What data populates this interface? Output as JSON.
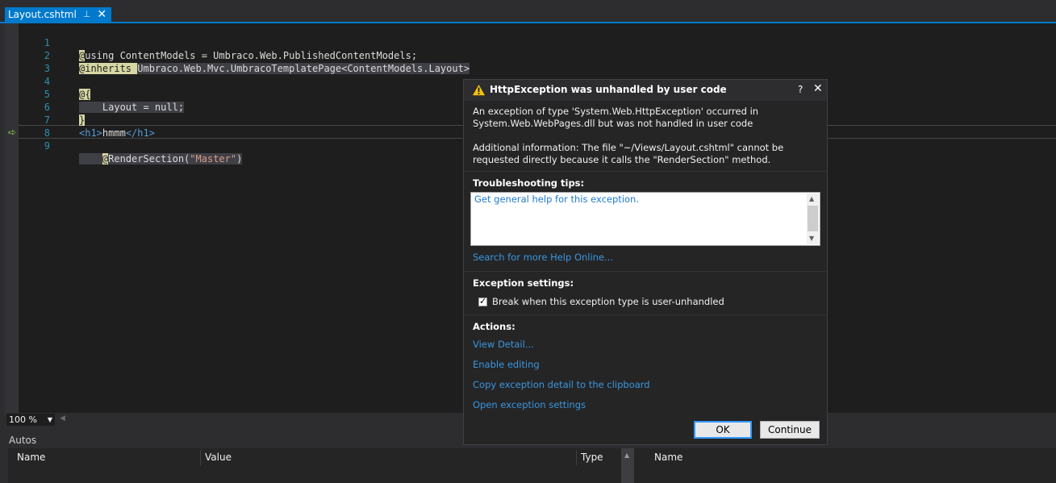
{
  "tab": {
    "title": "Layout.cshtml",
    "pin": "⊥",
    "close": "✕"
  },
  "editor": {
    "lines": [
      {
        "num": "1",
        "a": "@",
        "b": "using ContentModels = Umbraco.Web.PublishedContentModels;"
      },
      {
        "num": "2",
        "a": "@inherits ",
        "b": "Umbraco.Web.Mvc.UmbracoTemplatePage<ContentModels.Layout>"
      },
      {
        "num": "3",
        "a": "",
        "b": ""
      },
      {
        "num": "4",
        "a": "@{",
        "b": ""
      },
      {
        "num": "5",
        "a": "",
        "b": "    Layout = null;"
      },
      {
        "num": "6",
        "a": "}",
        "b": ""
      },
      {
        "num": "7",
        "tag1": "<h1>",
        "text": "hmmm",
        "tag2": "</h1>"
      },
      {
        "num": "8",
        "a": "",
        "b": ""
      },
      {
        "num": "9",
        "a": "@",
        "b": "RenderSection(",
        "str": "\"Master\"",
        "c": ")"
      }
    ]
  },
  "zoom": {
    "value": "100 %"
  },
  "autos": {
    "title": "Autos",
    "columns": [
      "Name",
      "Value",
      "Type"
    ],
    "right_columns": [
      "Name"
    ]
  },
  "dialog": {
    "title": "HttpException was unhandled by user code",
    "help": "?",
    "close": "✕",
    "message1": "An exception of type 'System.Web.HttpException' occurred in System.Web.WebPages.dll but was not handled in user code",
    "message2": "Additional information: The file \"~/Views/Layout.cshtml\" cannot be requested directly because it calls the \"RenderSection\" method.",
    "tips_title": "Troubleshooting tips:",
    "tips_link": "Get general help for this exception.",
    "search_link": "Search for more Help Online...",
    "settings_title": "Exception settings:",
    "checkbox_label": "Break when this exception type is user-unhandled",
    "checkbox_checked": true,
    "actions_title": "Actions:",
    "actions": [
      "View Detail...",
      "Enable editing",
      "Copy exception detail to the clipboard",
      "Open exception settings"
    ],
    "ok": "OK",
    "continue": "Continue"
  }
}
